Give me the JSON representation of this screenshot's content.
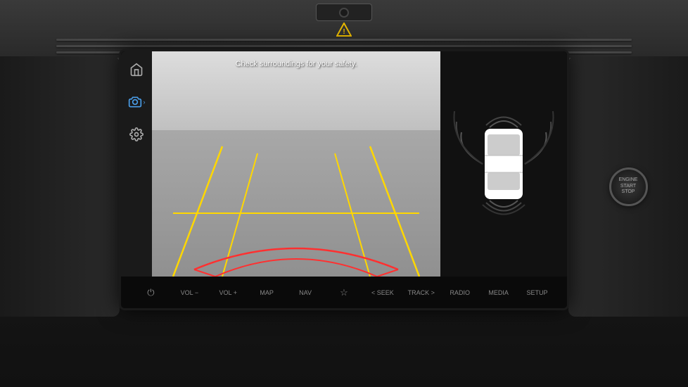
{
  "dashboard": {
    "background_color": "#1a1a1a"
  },
  "camera": {
    "safety_text": "Check surroundings for your safety."
  },
  "sidebar": {
    "icons": [
      {
        "name": "home",
        "label": "home",
        "active": false
      },
      {
        "name": "camera",
        "label": "camera",
        "active": true
      },
      {
        "name": "settings",
        "label": "settings",
        "active": false
      }
    ]
  },
  "buttons": [
    {
      "id": "power",
      "label": "⏻",
      "text": "",
      "show_text": false
    },
    {
      "id": "vol-minus",
      "label": "",
      "text": "VOL −",
      "show_text": true
    },
    {
      "id": "vol-plus",
      "label": "",
      "text": "VOL +",
      "show_text": true
    },
    {
      "id": "map",
      "label": "",
      "text": "MAP",
      "show_text": true
    },
    {
      "id": "nav",
      "label": "",
      "text": "NAV",
      "show_text": true
    },
    {
      "id": "star",
      "label": "☆",
      "text": "",
      "show_text": false
    },
    {
      "id": "seek-back",
      "label": "",
      "text": "< SEEK",
      "show_text": true
    },
    {
      "id": "track-fwd",
      "label": "",
      "text": "TRACK >",
      "show_text": true
    },
    {
      "id": "radio",
      "label": "",
      "text": "RADIO",
      "show_text": true
    },
    {
      "id": "media",
      "label": "",
      "text": "MEDIA",
      "show_text": true
    },
    {
      "id": "setup",
      "label": "",
      "text": "SETUP",
      "show_text": true
    }
  ],
  "engine_start": {
    "line1": "ENGINE",
    "line2": "START",
    "line3": "STOP"
  }
}
